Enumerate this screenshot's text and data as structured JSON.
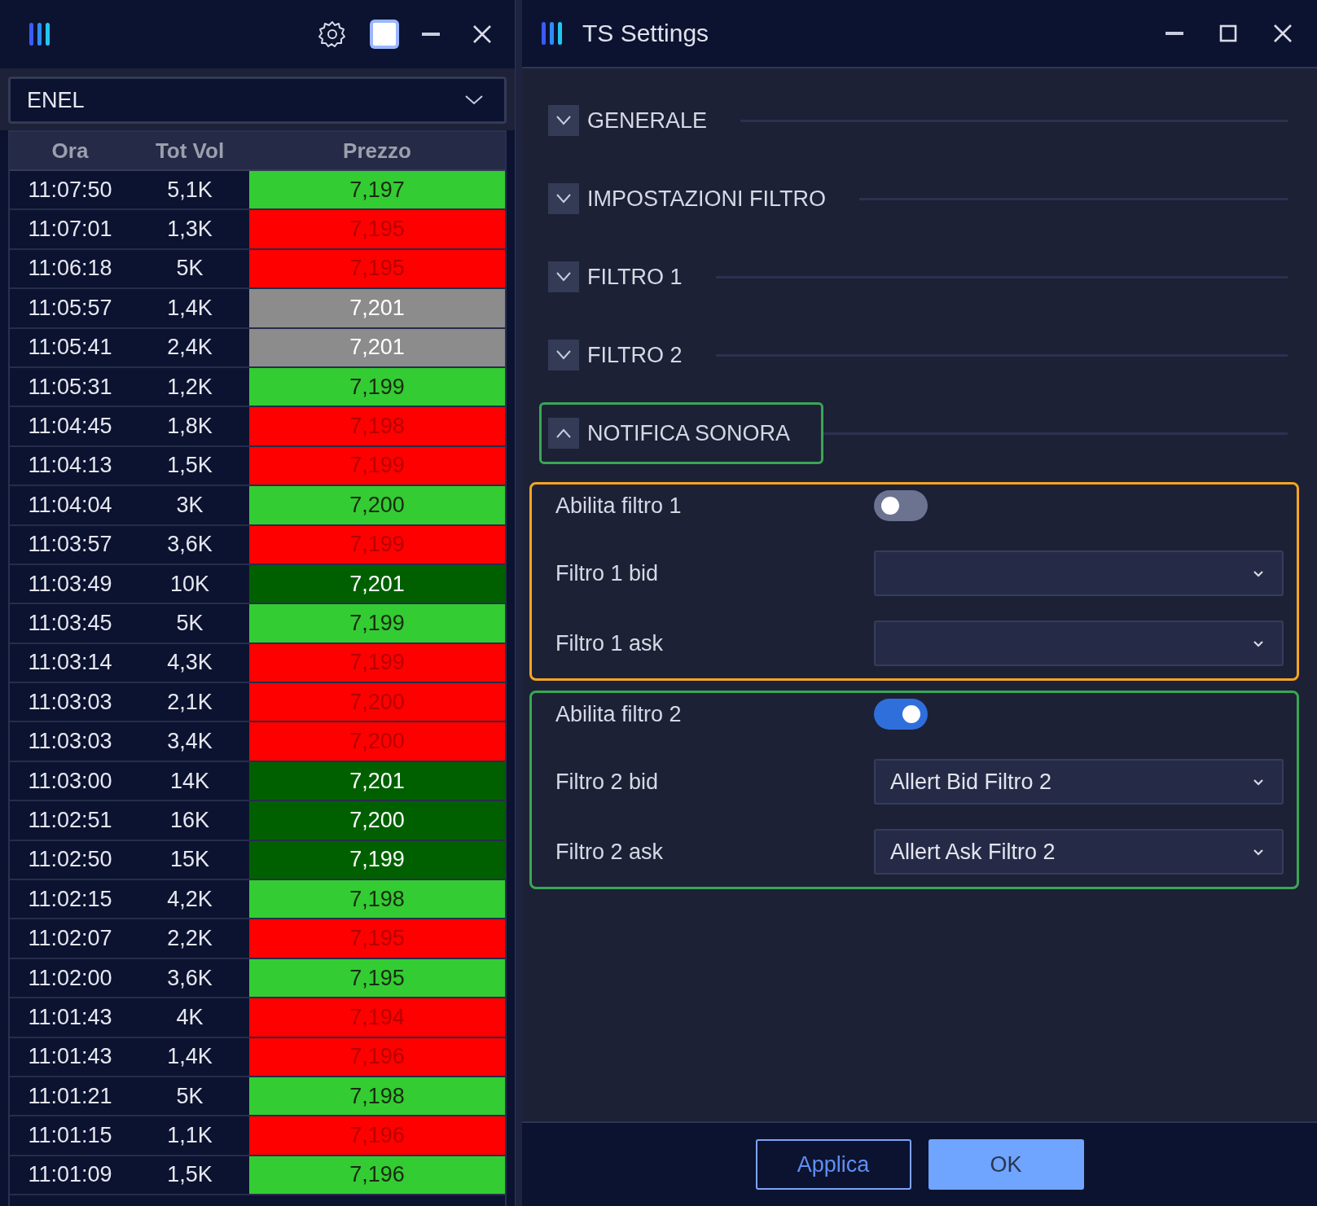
{
  "ticker_window": {
    "symbol": "ENEL",
    "columns": [
      "Ora",
      "Tot Vol",
      "Prezzo"
    ],
    "rows": [
      {
        "time": "11:07:50",
        "volume": "5,1K",
        "price": "7,197",
        "kind": "up"
      },
      {
        "time": "11:07:01",
        "volume": "1,3K",
        "price": "7,195",
        "kind": "down"
      },
      {
        "time": "11:06:18",
        "volume": "5K",
        "price": "7,195",
        "kind": "down"
      },
      {
        "time": "11:05:57",
        "volume": "1,4K",
        "price": "7,201",
        "kind": "flat"
      },
      {
        "time": "11:05:41",
        "volume": "2,4K",
        "price": "7,201",
        "kind": "flat"
      },
      {
        "time": "11:05:31",
        "volume": "1,2K",
        "price": "7,199",
        "kind": "up"
      },
      {
        "time": "11:04:45",
        "volume": "1,8K",
        "price": "7,198",
        "kind": "down"
      },
      {
        "time": "11:04:13",
        "volume": "1,5K",
        "price": "7,199",
        "kind": "down"
      },
      {
        "time": "11:04:04",
        "volume": "3K",
        "price": "7,200",
        "kind": "up"
      },
      {
        "time": "11:03:57",
        "volume": "3,6K",
        "price": "7,199",
        "kind": "down"
      },
      {
        "time": "11:03:49",
        "volume": "10K",
        "price": "7,201",
        "kind": "strong"
      },
      {
        "time": "11:03:45",
        "volume": "5K",
        "price": "7,199",
        "kind": "up"
      },
      {
        "time": "11:03:14",
        "volume": "4,3K",
        "price": "7,199",
        "kind": "down"
      },
      {
        "time": "11:03:03",
        "volume": "2,1K",
        "price": "7,200",
        "kind": "down"
      },
      {
        "time": "11:03:03",
        "volume": "3,4K",
        "price": "7,200",
        "kind": "down"
      },
      {
        "time": "11:03:00",
        "volume": "14K",
        "price": "7,201",
        "kind": "strong"
      },
      {
        "time": "11:02:51",
        "volume": "16K",
        "price": "7,200",
        "kind": "strong"
      },
      {
        "time": "11:02:50",
        "volume": "15K",
        "price": "7,199",
        "kind": "strong"
      },
      {
        "time": "11:02:15",
        "volume": "4,2K",
        "price": "7,198",
        "kind": "up"
      },
      {
        "time": "11:02:07",
        "volume": "2,2K",
        "price": "7,195",
        "kind": "down"
      },
      {
        "time": "11:02:00",
        "volume": "3,6K",
        "price": "7,195",
        "kind": "up"
      },
      {
        "time": "11:01:43",
        "volume": "4K",
        "price": "7,194",
        "kind": "down"
      },
      {
        "time": "11:01:43",
        "volume": "1,4K",
        "price": "7,196",
        "kind": "down"
      },
      {
        "time": "11:01:21",
        "volume": "5K",
        "price": "7,198",
        "kind": "up"
      },
      {
        "time": "11:01:15",
        "volume": "1,1K",
        "price": "7,196",
        "kind": "down"
      },
      {
        "time": "11:01:09",
        "volume": "1,5K",
        "price": "7,196",
        "kind": "up"
      }
    ]
  },
  "settings_window": {
    "title": "TS Settings",
    "sections": [
      {
        "label": "GENERALE",
        "expanded": false
      },
      {
        "label": "IMPOSTAZIONI FILTRO",
        "expanded": false
      },
      {
        "label": "FILTRO 1",
        "expanded": false
      },
      {
        "label": "FILTRO 2",
        "expanded": false
      },
      {
        "label": "NOTIFICA SONORA",
        "expanded": true,
        "color": "#3aa655"
      }
    ],
    "filter_groups": [
      {
        "color": "#f5a623",
        "toggle": {
          "label": "Abilita filtro 1",
          "on": false
        },
        "fields": [
          {
            "label": "Filtro 1 bid"
          },
          {
            "label": "Filtro 1 ask"
          }
        ]
      },
      {
        "color": "#3aa655",
        "toggle": {
          "label": "Abilita filtro 2",
          "on": true
        },
        "fields": [
          {
            "label": "Filtro 2 bid",
            "value": "Allert Bid Filtro 2"
          },
          {
            "label": "Filtro 2 ask",
            "value": "Allert Ask Filtro 2"
          }
        ]
      }
    ],
    "buttons": [
      {
        "label": "Applica",
        "kind": "secondary"
      },
      {
        "label": "OK",
        "kind": "primary"
      }
    ]
  }
}
